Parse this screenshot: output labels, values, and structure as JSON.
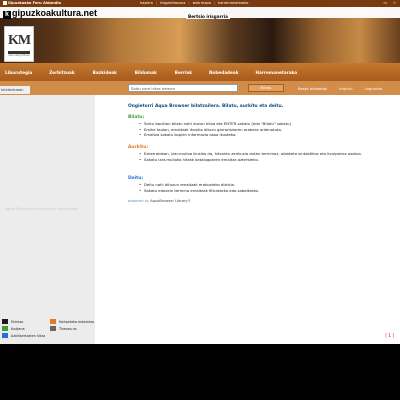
{
  "topbar": {
    "site": "Gipuzkoako Foru Aldundia",
    "links": [
      "hasiera",
      "irisgarritasuna",
      "web mapa",
      "harremanetarako"
    ],
    "langs": [
      "es",
      "fr"
    ]
  },
  "header": {
    "logo_text": "gipuzkoakultura.net",
    "logo_k": "k",
    "stair_label": "Bertsio irisgarria",
    "km_logo": "KM",
    "km_sub": "Liburutegi Etxea"
  },
  "nav": {
    "items": [
      "Liburutegia",
      "Zerbitzuak",
      "Bazkideak",
      "Bildumak",
      "Berriak",
      "Nobedadeak",
      "Harremanetarako"
    ]
  },
  "sidebar": {
    "tab_label": "Intzlerduean",
    "caption": "Koldo Mitxelena Kulturuneko Liburutegia",
    "legend": [
      {
        "label": "Ekintza",
        "color": "#1a1a1a"
      },
      {
        "label": "Nahasketa eskaintza",
        "color": "#e87820"
      },
      {
        "label": "Kudjena",
        "color": "#3aa23a"
      },
      {
        "label": "Thesaurus",
        "color": "#666666"
      },
      {
        "label": "Azkilisertzaten hitza",
        "color": "#2a6fd6"
      }
    ]
  },
  "search": {
    "placeholder": "Saitu zure hitza hemen",
    "button": "Bilatu",
    "links": [
      "Beste bilaketak",
      "Impriin",
      "Laguntza"
    ]
  },
  "main": {
    "intro": "Ongietorri Aqua Browser bilatzailera. Bilatu, aurkitu eta deitu.",
    "sections": [
      {
        "title": "Bilatu:",
        "color": "#3aa23a",
        "items": [
          "Sartu bauklan bilatu nahi duzun hitza eta ENTER sakatu (edo \"Bilatu\" sakatu)",
          "Emike taulan, emaitzak ikusiko dituzu garrantziaren arabera ordenatuta.",
          "Emaitza sakatu kopien informazio osoa ikusteko."
        ]
      },
      {
        "title": "Aurkitu:",
        "color": "#e87820",
        "items": [
          "Ezkerraldean, izar-mulioa ikusiko da, hitzaren zerikusia duten terminoz, aldaketa sintaktikoz eta itzulpenez osatua.",
          "Sakatu izar-mulioko hitzak katalogoaren emaitza aztertzeko."
        ]
      },
      {
        "title": "Deitu:",
        "color": "#2a6fd6",
        "items": [
          "Deitu nahi dituzun emaitzak erakusteko diztiria.",
          "Sakatu edozein termino emaitzak filtratzeko edo zabaltzeko."
        ]
      }
    ],
    "powered_prefix": "powered by",
    "powered_brand": "AquaBrowser Library",
    "powered_mark": "®",
    "pager": "[ 1 ]"
  }
}
